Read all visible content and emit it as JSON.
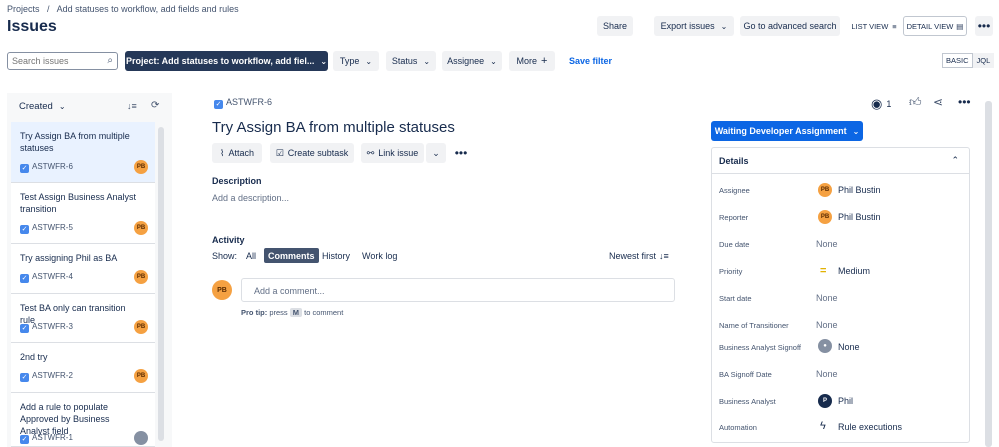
{
  "breadcrumb": {
    "root": "Projects",
    "separator": "/",
    "project": "Add statuses to workflow, add fields and rules"
  },
  "page_title": "Issues",
  "header_actions": {
    "share": "Share",
    "export": "Export issues",
    "advanced_search": "Go to advanced search",
    "list_view": "LIST VIEW",
    "detail_view": "DETAIL VIEW"
  },
  "filters": {
    "search_placeholder": "Search issues",
    "project": "Project: Add statuses to workflow, add fiel...",
    "type": "Type",
    "status": "Status",
    "assignee": "Assignee",
    "more": "More",
    "save_filter": "Save filter",
    "basic": "BASIC",
    "jql": "JQL"
  },
  "list": {
    "sort_label": "Created",
    "items": [
      {
        "title": "Try Assign BA from multiple statuses",
        "key": "ASTWFR-6",
        "avatar": "PB",
        "selected": true
      },
      {
        "title": "Test Assign Business Analyst transition",
        "key": "ASTWFR-5",
        "avatar": "PB",
        "selected": false
      },
      {
        "title": "Try assigning Phil as BA",
        "key": "ASTWFR-4",
        "avatar": "PB",
        "selected": false
      },
      {
        "title": "Test BA only can transition rule",
        "key": "ASTWFR-3",
        "avatar": "PB",
        "selected": false
      },
      {
        "title": "2nd try",
        "key": "ASTWFR-2",
        "avatar": "PB",
        "selected": false
      },
      {
        "title": "Add a rule to populate Approved by Business Analyst field",
        "key": "ASTWFR-1",
        "avatar": "",
        "selected": false
      }
    ]
  },
  "issue": {
    "key": "ASTWFR-6",
    "title": "Try Assign BA from multiple statuses",
    "watchers": "1",
    "actions": {
      "attach": "Attach",
      "create_subtask": "Create subtask",
      "link_issue": "Link issue"
    },
    "description_heading": "Description",
    "description_placeholder": "Add a description...",
    "activity_heading": "Activity",
    "show_label": "Show:",
    "activity_tabs": [
      "All",
      "Comments",
      "History",
      "Work log"
    ],
    "sort_order": "Newest first",
    "comment_avatar": "PB",
    "comment_placeholder": "Add a comment...",
    "pro_tip": {
      "prefix": "Pro tip:",
      "press": "press",
      "key": "M",
      "suffix": "to comment"
    }
  },
  "status_button": "Waiting Developer Assignment",
  "details": {
    "heading": "Details",
    "fields": [
      {
        "label": "Assignee",
        "value": "Phil Bustin",
        "avatar": "PB"
      },
      {
        "label": "Reporter",
        "value": "Phil Bustin",
        "avatar": "PB"
      },
      {
        "label": "Due date",
        "value": "None"
      },
      {
        "label": "Priority",
        "value": "Medium"
      },
      {
        "label": "Start date",
        "value": "None"
      },
      {
        "label": "Name of Transitioner",
        "value": "None"
      },
      {
        "label": "Business Analyst Signoff",
        "value": "None"
      },
      {
        "label": "BA Signoff Date",
        "value": "None"
      },
      {
        "label": "Business Analyst",
        "value": "Phil",
        "avatar": "P"
      },
      {
        "label": "Automation",
        "value": "Rule executions"
      }
    ]
  },
  "colors": {
    "accent": "#0c66e4",
    "dark_button": "#253858",
    "selected_card": "#e9f2ff",
    "avatar": "#f5a142",
    "priority": "#e2b203"
  }
}
